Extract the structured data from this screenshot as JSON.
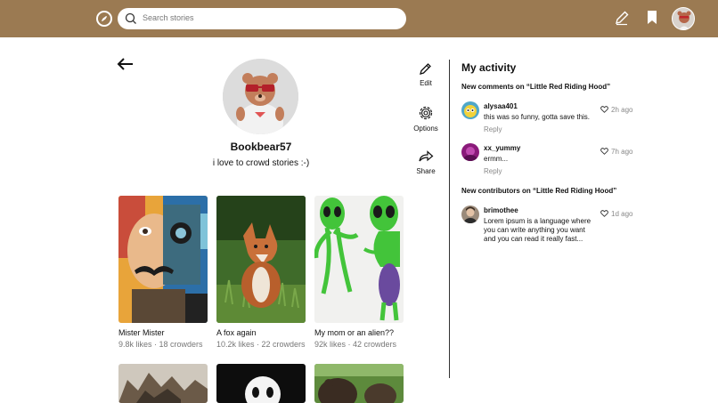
{
  "topbar": {
    "search_placeholder": "Search stories",
    "icons": [
      "compass-icon",
      "search-icon",
      "pencil-icon",
      "bookmark-icon",
      "user-avatar"
    ],
    "color": "#9b7a52"
  },
  "profile": {
    "username": "Bookbear57",
    "bio": "i love to crowd stories :-)"
  },
  "actions": [
    {
      "label": "Edit",
      "icon": "pencil-icon"
    },
    {
      "label": "Options",
      "icon": "gear-icon"
    },
    {
      "label": "Share",
      "icon": "share-icon"
    }
  ],
  "stories": [
    {
      "title": "Mister Mister",
      "meta": "9.8k likes · 18 crowders"
    },
    {
      "title": "A fox again",
      "meta": "10.2k likes · 22 crowders"
    },
    {
      "title": "My mom or an alien??",
      "meta": "92k likes · 42 crowders"
    }
  ],
  "activity": {
    "title": "My activity",
    "sections": [
      {
        "heading": "New comments on “Little Red Riding Hood”",
        "items": [
          {
            "user": "alysaa401",
            "text": "this was so funny, gotta save this.",
            "reply": "Reply",
            "time": "2h ago"
          },
          {
            "user": "xx_yummy",
            "text": "ermm...",
            "reply": "Reply",
            "time": "7h ago"
          }
        ]
      },
      {
        "heading": "New contributors on “Little Red Riding Hood”",
        "items": [
          {
            "user": "brimothee",
            "text": "Lorem ipsum is a language where you can write anything you want and you can read it really fast...",
            "time": "1d ago"
          }
        ]
      }
    ]
  }
}
